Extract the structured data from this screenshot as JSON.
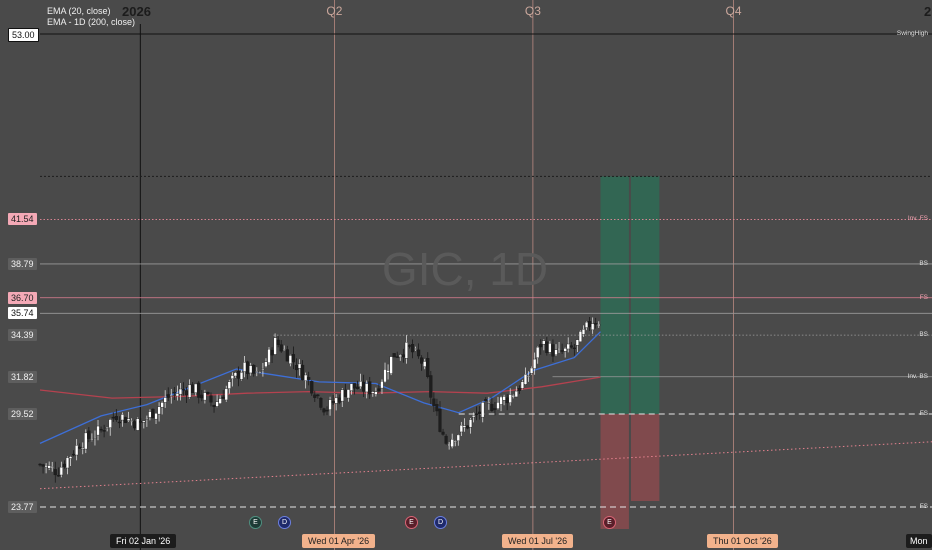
{
  "indicators": [
    "EMA (20, close)",
    "EMA - 1D (200, close)"
  ],
  "watermark": "GIC, 1D",
  "year_label": "2026",
  "year_label_right": "2",
  "quarters": [
    "Q2",
    "Q3",
    "Q4"
  ],
  "price_labels": [
    {
      "text": "53.00",
      "value": 53.0,
      "style": "white"
    },
    {
      "text": "41.54",
      "value": 41.54,
      "style": "pink"
    },
    {
      "text": "38.79",
      "value": 38.79,
      "style": "grey"
    },
    {
      "text": "36.70",
      "value": 36.7,
      "style": "pink"
    },
    {
      "text": "35.74",
      "value": 35.74,
      "style": "white"
    },
    {
      "text": "34.39",
      "value": 34.39,
      "style": "grey"
    },
    {
      "text": "31.82",
      "value": 31.82,
      "style": "grey"
    },
    {
      "text": "29.52",
      "value": 29.52,
      "style": "grey"
    },
    {
      "text": "23.77",
      "value": 23.77,
      "style": "grey"
    }
  ],
  "levels": [
    {
      "tag": "SwingHigh",
      "value": 53.0,
      "style": "solid-dark"
    },
    {
      "tag": "",
      "value": 44.2,
      "style": "dotted-dark"
    },
    {
      "tag": "Inv. FS",
      "value": 41.54,
      "style": "dotted-pink"
    },
    {
      "tag": "BS",
      "value": 38.79,
      "style": "solid-grey"
    },
    {
      "tag": "FS",
      "value": 36.7,
      "style": "solid-pink"
    },
    {
      "tag": "",
      "value": 35.74,
      "style": "solid-grey"
    },
    {
      "tag": "BS",
      "value": 34.39,
      "style": "dotted-grey"
    },
    {
      "tag": "Inv. BS",
      "value": 31.82,
      "style": "solid-grey"
    },
    {
      "tag": "FS",
      "value": 29.52,
      "style": "dashed-white"
    },
    {
      "tag": "FS",
      "value": 23.77,
      "style": "dashed-white"
    }
  ],
  "date_labels": [
    "Fri 02 Jan '26",
    "Wed 01 Apr '26",
    "Wed 01 Jul '26",
    "Thu 01 Oct '26",
    "Mon"
  ],
  "events": [
    {
      "symbol": "E",
      "kind": "earnings"
    },
    {
      "symbol": "D",
      "kind": "dividend"
    },
    {
      "symbol": "E",
      "kind": "earnings"
    },
    {
      "symbol": "D",
      "kind": "dividend"
    },
    {
      "symbol": "E",
      "kind": "earnings"
    }
  ],
  "colors": {
    "background": "#4a4a4a",
    "up": "#ffffff",
    "down": "#1e1e1e",
    "ema20": "#3d6fd8",
    "ema200": "#b5424f",
    "target": "#2e6b55",
    "stop": "#8a4a4e"
  },
  "chart_data": {
    "type": "candlestick",
    "symbol": "GIC",
    "interval": "1D",
    "ylim": [
      23.0,
      54.0
    ],
    "x_range": [
      "2025-11-17",
      "2026-12-31"
    ],
    "position": {
      "entry": 29.52,
      "target": 44.2,
      "stop": 23.77,
      "start": "2026-08-01",
      "end": "2026-08-28"
    },
    "ema20_keypoints": [
      [
        "2025-11-17",
        27.7
      ],
      [
        "2025-12-15",
        29.4
      ],
      [
        "2026-01-05",
        30.1
      ],
      [
        "2026-02-15",
        32.3
      ],
      [
        "2026-03-01",
        32.0
      ],
      [
        "2026-03-25",
        31.5
      ],
      [
        "2026-04-20",
        31.4
      ],
      [
        "2026-05-12",
        30.2
      ],
      [
        "2026-05-28",
        29.6
      ],
      [
        "2026-06-12",
        30.5
      ],
      [
        "2026-07-01",
        32.2
      ],
      [
        "2026-07-20",
        33.0
      ],
      [
        "2026-08-01",
        34.6
      ]
    ],
    "ema200_keypoints": [
      [
        "2025-11-17",
        31.0
      ],
      [
        "2025-12-20",
        30.5
      ],
      [
        "2026-01-20",
        30.6
      ],
      [
        "2026-02-20",
        30.8
      ],
      [
        "2026-03-20",
        30.9
      ],
      [
        "2026-04-15",
        30.8
      ],
      [
        "2026-05-15",
        30.9
      ],
      [
        "2026-06-10",
        30.8
      ],
      [
        "2026-07-05",
        31.2
      ],
      [
        "2026-08-01",
        31.8
      ]
    ],
    "trendline": {
      "start": [
        "2025-11-17",
        24.9
      ],
      "end": [
        "2026-12-31",
        27.8
      ]
    },
    "close_keypoints": [
      [
        "2025-11-17",
        26.4
      ],
      [
        "2025-11-25",
        26.0
      ],
      [
        "2025-12-05",
        27.7
      ],
      [
        "2025-12-15",
        28.5
      ],
      [
        "2025-12-22",
        29.5
      ],
      [
        "2026-01-02",
        28.9
      ],
      [
        "2026-01-15",
        30.6
      ],
      [
        "2026-01-25",
        31.2
      ],
      [
        "2026-02-05",
        30.1
      ],
      [
        "2026-02-18",
        32.4
      ],
      [
        "2026-02-25",
        31.8
      ],
      [
        "2026-03-05",
        34.0
      ],
      [
        "2026-03-12",
        33.0
      ],
      [
        "2026-03-20",
        31.6
      ],
      [
        "2026-03-28",
        29.8
      ],
      [
        "2026-04-08",
        31.2
      ],
      [
        "2026-04-20",
        31.0
      ],
      [
        "2026-04-28",
        33.2
      ],
      [
        "2026-05-05",
        33.6
      ],
      [
        "2026-05-12",
        32.6
      ],
      [
        "2026-05-16",
        30.2
      ],
      [
        "2026-05-22",
        27.8
      ],
      [
        "2026-05-30",
        28.6
      ],
      [
        "2026-06-08",
        29.8
      ],
      [
        "2026-06-20",
        30.6
      ],
      [
        "2026-06-28",
        31.6
      ],
      [
        "2026-07-05",
        34.0
      ],
      [
        "2026-07-12",
        33.2
      ],
      [
        "2026-07-20",
        33.6
      ],
      [
        "2026-07-28",
        35.3
      ],
      [
        "2026-08-01",
        35.3
      ]
    ]
  }
}
